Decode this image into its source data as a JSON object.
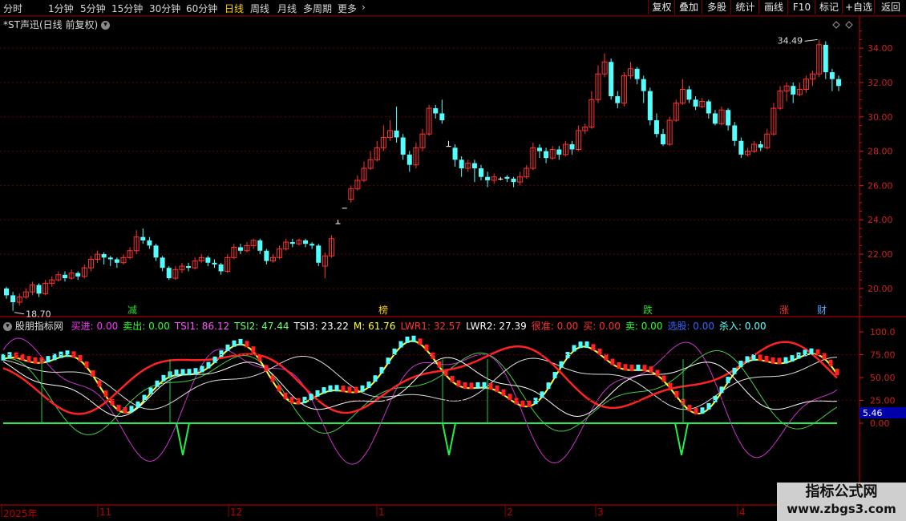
{
  "toolbar": {
    "periods": [
      {
        "label": "分时",
        "active": false
      },
      {
        "label": "1分钟",
        "active": false
      },
      {
        "label": "5分钟",
        "active": false
      },
      {
        "label": "15分钟",
        "active": false
      },
      {
        "label": "30分钟",
        "active": false
      },
      {
        "label": "60分钟",
        "active": false
      },
      {
        "label": "日线",
        "active": true
      },
      {
        "label": "周线",
        "active": false
      },
      {
        "label": "月线",
        "active": false
      },
      {
        "label": "多周期",
        "active": false
      },
      {
        "label": "更多",
        "active": false
      }
    ],
    "buttons": [
      "复权",
      "叠加",
      "多股",
      "统计",
      "画线",
      "F10",
      "标记",
      "+自选",
      "返回"
    ]
  },
  "main_chart": {
    "title": "*ST声迅(日线 前复权)",
    "high_label": "34.49",
    "low_label": "18.70",
    "y_ticks": [
      "34.00",
      "32.00",
      "30.00",
      "28.00",
      "26.00",
      "24.00",
      "22.00",
      "20.00"
    ],
    "event_markers": [
      {
        "text": "减",
        "color": "#33dd33"
      },
      {
        "text": "榜",
        "color": "#ffcc00"
      },
      {
        "text": "跌",
        "color": "#33dd33"
      },
      {
        "text": "涨",
        "color": "#ff3333"
      },
      {
        "text": "财",
        "color": "#55aaff"
      }
    ]
  },
  "indicator": {
    "name": "股朋指标网",
    "values": [
      {
        "label": "买进: 0.00",
        "color": "#ff33ff"
      },
      {
        "label": "卖出: 0.00",
        "color": "#33ff33"
      },
      {
        "label": "TSI1: 86.12",
        "color": "#ff55ff"
      },
      {
        "label": "TSI2: 47.44",
        "color": "#66ff66"
      },
      {
        "label": "TSI3: 23.22",
        "color": "#ffffff"
      },
      {
        "label": "M: 61.76",
        "color": "#ffff33"
      },
      {
        "label": "LWR1: 32.57",
        "color": "#ff3333"
      },
      {
        "label": "LWR2: 27.39",
        "color": "#ffffff"
      },
      {
        "label": "很准: 0.00",
        "color": "#ff3333"
      },
      {
        "label": "买: 0.00",
        "color": "#ff3333"
      },
      {
        "label": "卖: 0.00",
        "color": "#33ff33"
      },
      {
        "label": "选股: 0.00",
        "color": "#3366ff"
      },
      {
        "label": "杀入: 0.00",
        "color": "#66ffff"
      }
    ],
    "y_ticks": [
      "100.0",
      "75.00",
      "50.00",
      "25.00",
      "0.00"
    ],
    "cursor_value": "5.46"
  },
  "date_axis": [
    "2025年",
    "11",
    "12",
    "1",
    "2",
    "3",
    "4"
  ],
  "watermark": {
    "line1": "指标公式网",
    "line2": "www.zbgs3.com"
  },
  "chart_data": {
    "type": "candlestick",
    "ylim": [
      18.5,
      35.5
    ],
    "candles": [
      [
        20.0,
        19.6,
        20.1,
        19.4
      ],
      [
        19.6,
        19.2,
        19.8,
        18.7
      ],
      [
        19.2,
        19.5,
        19.7,
        19.0
      ],
      [
        19.5,
        19.8,
        20.0,
        19.4
      ],
      [
        19.8,
        20.2,
        20.4,
        19.6
      ],
      [
        20.2,
        19.7,
        20.3,
        19.5
      ],
      [
        19.7,
        20.3,
        20.5,
        19.6
      ],
      [
        20.3,
        20.5,
        20.7,
        20.1
      ],
      [
        20.5,
        20.8,
        21.0,
        20.4
      ],
      [
        20.8,
        20.6,
        21.0,
        20.4
      ],
      [
        20.6,
        20.9,
        21.1,
        20.5
      ],
      [
        20.9,
        20.7,
        21.0,
        20.5
      ],
      [
        20.7,
        21.2,
        21.4,
        20.6
      ],
      [
        21.2,
        21.7,
        21.9,
        21.0
      ],
      [
        21.7,
        22.0,
        22.2,
        21.5
      ],
      [
        22.0,
        21.8,
        22.1,
        21.4
      ],
      [
        21.8,
        21.7,
        21.9,
        21.3
      ],
      [
        21.7,
        21.5,
        21.8,
        21.2
      ],
      [
        21.5,
        21.8,
        22.0,
        21.4
      ],
      [
        21.8,
        22.2,
        22.4,
        21.7
      ],
      [
        22.2,
        23.0,
        23.4,
        22.0
      ],
      [
        23.0,
        22.8,
        23.5,
        22.6
      ],
      [
        22.8,
        22.5,
        23.0,
        22.3
      ],
      [
        22.5,
        21.8,
        22.6,
        21.6
      ],
      [
        21.8,
        21.2,
        21.9,
        21.0
      ],
      [
        21.2,
        20.6,
        21.3,
        20.5
      ],
      [
        20.6,
        21.1,
        21.3,
        20.5
      ],
      [
        21.1,
        21.3,
        21.5,
        20.9
      ],
      [
        21.3,
        21.2,
        21.5,
        21.0
      ],
      [
        21.2,
        21.6,
        21.8,
        21.1
      ],
      [
        21.6,
        21.8,
        22.0,
        21.5
      ],
      [
        21.8,
        21.5,
        21.9,
        21.3
      ],
      [
        21.5,
        21.4,
        21.7,
        21.2
      ],
      [
        21.4,
        21.0,
        21.5,
        20.8
      ],
      [
        21.0,
        21.8,
        22.0,
        20.9
      ],
      [
        21.8,
        22.4,
        22.6,
        21.7
      ],
      [
        22.4,
        22.2,
        22.6,
        22.0
      ],
      [
        22.2,
        22.5,
        22.7,
        22.1
      ],
      [
        22.5,
        22.8,
        22.9,
        22.3
      ],
      [
        22.8,
        22.2,
        22.9,
        22.0
      ],
      [
        22.2,
        21.6,
        22.3,
        21.4
      ],
      [
        21.6,
        21.8,
        22.0,
        21.5
      ],
      [
        21.8,
        22.3,
        22.5,
        21.7
      ],
      [
        22.3,
        22.7,
        22.9,
        22.2
      ],
      [
        22.7,
        22.6,
        22.9,
        22.4
      ],
      [
        22.6,
        22.8,
        22.9,
        22.5
      ],
      [
        22.8,
        22.6,
        22.9,
        22.4
      ],
      [
        22.6,
        22.5,
        22.7,
        22.3
      ],
      [
        22.5,
        21.5,
        22.6,
        21.3
      ],
      [
        21.3,
        21.9,
        22.1,
        20.6
      ],
      [
        21.9,
        22.9,
        23.1,
        21.8
      ],
      [
        23.8,
        23.8,
        24.0,
        23.8
      ],
      [
        24.7,
        24.7,
        24.7,
        24.7
      ],
      [
        25.2,
        25.8,
        26.0,
        25.0
      ],
      [
        25.8,
        26.3,
        26.6,
        25.7
      ],
      [
        26.3,
        27.0,
        27.4,
        26.2
      ],
      [
        27.0,
        27.5,
        28.0,
        26.9
      ],
      [
        27.5,
        28.2,
        28.6,
        27.4
      ],
      [
        28.2,
        28.8,
        29.5,
        28.0
      ],
      [
        28.8,
        29.2,
        29.8,
        28.6
      ],
      [
        29.2,
        28.8,
        30.6,
        28.5
      ],
      [
        28.8,
        27.8,
        29.0,
        27.5
      ],
      [
        27.8,
        27.2,
        28.0,
        26.8
      ],
      [
        27.2,
        28.2,
        28.5,
        27.0
      ],
      [
        28.2,
        29.0,
        29.3,
        28.0
      ],
      [
        29.0,
        30.5,
        30.7,
        28.9
      ],
      [
        30.5,
        30.2,
        30.7,
        29.9
      ],
      [
        30.2,
        29.8,
        31.0,
        29.6
      ],
      [
        28.3,
        28.3,
        28.6,
        28.3
      ],
      [
        28.2,
        27.5,
        28.4,
        27.1
      ],
      [
        27.5,
        27.0,
        27.7,
        26.5
      ],
      [
        27.0,
        27.3,
        27.5,
        26.8
      ],
      [
        27.3,
        27.0,
        27.5,
        26.2
      ],
      [
        27.0,
        26.5,
        27.2,
        26.3
      ],
      [
        26.5,
        26.3,
        26.8,
        25.9
      ],
      [
        26.3,
        26.5,
        26.7,
        26.1
      ],
      [
        26.4,
        26.4,
        26.5,
        26.3
      ],
      [
        26.5,
        26.4,
        26.6,
        26.2
      ],
      [
        26.4,
        26.2,
        26.5,
        25.9
      ],
      [
        26.2,
        26.5,
        26.8,
        26.0
      ],
      [
        26.5,
        27.0,
        27.2,
        26.4
      ],
      [
        27.0,
        28.2,
        28.5,
        26.9
      ],
      [
        28.2,
        28.0,
        28.4,
        27.6
      ],
      [
        28.0,
        27.6,
        28.2,
        27.3
      ],
      [
        27.6,
        28.1,
        28.3,
        27.5
      ],
      [
        28.1,
        27.8,
        28.3,
        27.5
      ],
      [
        27.8,
        28.4,
        28.6,
        27.7
      ],
      [
        28.4,
        28.1,
        28.6,
        27.8
      ],
      [
        28.1,
        29.2,
        29.5,
        28.0
      ],
      [
        29.2,
        29.4,
        29.6,
        29.0
      ],
      [
        29.4,
        31.0,
        31.5,
        29.3
      ],
      [
        31.0,
        32.5,
        33.0,
        30.8
      ],
      [
        32.5,
        33.2,
        33.7,
        32.3
      ],
      [
        33.2,
        31.2,
        33.4,
        31.0
      ],
      [
        31.2,
        30.8,
        31.5,
        30.5
      ],
      [
        30.8,
        32.4,
        32.6,
        30.6
      ],
      [
        32.4,
        32.8,
        33.2,
        32.2
      ],
      [
        32.8,
        32.2,
        32.9,
        31.9
      ],
      [
        32.2,
        31.5,
        32.4,
        30.8
      ],
      [
        31.5,
        29.8,
        31.7,
        29.5
      ],
      [
        29.8,
        29.0,
        30.2,
        28.8
      ],
      [
        29.0,
        28.4,
        29.3,
        28.3
      ],
      [
        28.4,
        29.8,
        30.0,
        28.3
      ],
      [
        29.8,
        30.8,
        31.0,
        29.7
      ],
      [
        30.8,
        31.6,
        32.2,
        30.7
      ],
      [
        31.6,
        31.0,
        31.8,
        30.8
      ],
      [
        31.0,
        30.6,
        31.2,
        30.4
      ],
      [
        30.6,
        30.9,
        31.1,
        30.5
      ],
      [
        30.9,
        30.2,
        31.0,
        29.9
      ],
      [
        30.2,
        29.6,
        30.4,
        29.5
      ],
      [
        29.6,
        30.4,
        30.6,
        29.5
      ],
      [
        30.4,
        29.5,
        30.5,
        29.2
      ],
      [
        29.5,
        28.6,
        29.7,
        28.3
      ],
      [
        28.6,
        27.8,
        28.8,
        27.6
      ],
      [
        27.8,
        28.0,
        28.2,
        27.7
      ],
      [
        28.0,
        28.4,
        28.6,
        27.9
      ],
      [
        28.4,
        28.2,
        28.6,
        28.0
      ],
      [
        28.2,
        29.0,
        29.3,
        28.1
      ],
      [
        29.0,
        30.5,
        30.8,
        28.9
      ],
      [
        30.5,
        31.5,
        31.8,
        30.4
      ],
      [
        31.5,
        31.8,
        32.0,
        30.9
      ],
      [
        31.8,
        31.3,
        32.0,
        30.8
      ],
      [
        31.3,
        31.6,
        32.0,
        31.2
      ],
      [
        31.6,
        32.2,
        32.4,
        31.4
      ],
      [
        32.2,
        32.5,
        32.7,
        31.8
      ],
      [
        32.5,
        34.2,
        34.5,
        32.3
      ],
      [
        34.2,
        32.6,
        34.4,
        32.2
      ],
      [
        32.6,
        32.2,
        32.8,
        31.5
      ],
      [
        32.2,
        31.8,
        32.4,
        31.5
      ]
    ]
  }
}
